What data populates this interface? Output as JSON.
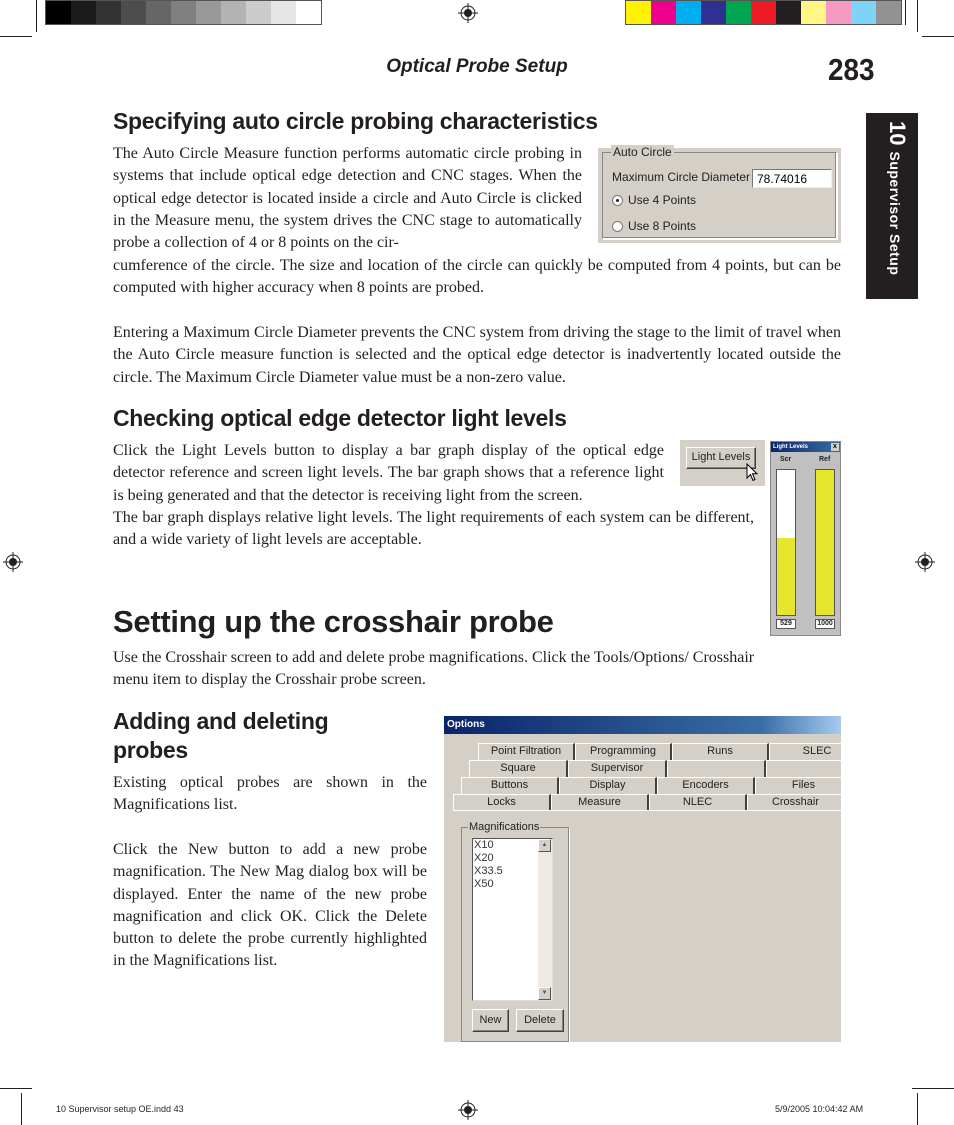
{
  "print_marks": {
    "grayscale_swatches": [
      "#000000",
      "#1a1a1a",
      "#333333",
      "#4d4d4d",
      "#666666",
      "#808080",
      "#999999",
      "#b3b3b3",
      "#cccccc",
      "#e6e6e6",
      "#ffffff"
    ],
    "color_swatches": [
      "#fff200",
      "#ec008c",
      "#00aeef",
      "#2e3192",
      "#00a651",
      "#ed1c24",
      "#231f20",
      "#fff685",
      "#f69ac4",
      "#7dd4f6",
      "#929292"
    ]
  },
  "header": {
    "running_head": "Optical Probe Setup",
    "page_number": "283"
  },
  "chapter_tab": {
    "number": "10",
    "name": "Supervisor Setup"
  },
  "sections": {
    "auto_circle": {
      "heading": "Specifying auto circle probing characteristics",
      "para1_wrapped": "The Auto Circle Measure function performs automatic circle probing in systems that include optical edge detection and CNC stages. When the optical edge detector is located inside a circle and Auto Circle is clicked in the Measure menu, the system drives the CNC stage to automatically probe a collection of 4 or 8 points on the cir-",
      "para1_cont": "cumference of the circle.  The size and location of the circle can quickly be computed from 4 points, but can be computed with higher accuracy when 8 points are probed.",
      "para2": "Entering a Maximum Circle Diameter prevents the CNC system from driving the stage to the limit of travel when the Auto Circle measure function is selected and the optical edge detector is inadvertently located outside the circle.  The Maximum Circle Diameter value must be a non-zero value."
    },
    "light_levels": {
      "heading": "Checking optical edge detector light levels",
      "para1": "Click the Light Levels button to display a bar graph display of the optical edge detector reference and screen light levels.  The bar graph shows that a reference light is being generated and that the detector is receiving light from the screen.",
      "para2": "The bar graph displays relative light levels. The light requirements of each system can be different, and a wide variety of light levels are acceptable."
    },
    "crosshair": {
      "heading": "Setting up the crosshair probe",
      "para": "Use the Crosshair screen to add and delete probe magnifications.   Click the Tools/Options/ Crosshair menu item to display the Crosshair probe screen."
    },
    "add_delete": {
      "heading_line1": "Adding and deleting",
      "heading_line2": "probes",
      "para1": "Existing optical probes are shown in the Magnifications list.",
      "para2": "Click the New button to add a new probe magnification.  The New Mag dialog box will be displayed. Enter the name of the new probe magnification and click OK.  Click the Delete button to delete the probe currently highlighted in the Magnifications list."
    }
  },
  "auto_circle_panel": {
    "group_label": "Auto Circle",
    "diameter_label": "Maximum Circle Diameter",
    "diameter_value": "78.74016",
    "options": [
      {
        "label": "Use 4 Points",
        "checked": true
      },
      {
        "label": "Use 8 Points",
        "checked": false
      }
    ]
  },
  "light_levels_button": {
    "label": "Light Levels"
  },
  "light_levels_window": {
    "title": "Light Levels",
    "close_glyph": "x",
    "scale_max": 1000,
    "bars": [
      {
        "label": "Scr",
        "value": 529
      },
      {
        "label": "Ref",
        "value": 1000
      }
    ],
    "bar_color": "#e6e62e"
  },
  "options_dialog": {
    "title": "Options",
    "tab_rows": [
      [
        "Point Filtration",
        "Programming",
        "Runs",
        "SLEC"
      ],
      [
        "Square",
        "Supervisor",
        "",
        ""
      ],
      [
        "Buttons",
        "Display",
        "Encoders",
        "Files"
      ],
      [
        "Locks",
        "Measure",
        "NLEC",
        "Crosshair"
      ]
    ],
    "active_tab": "Crosshair",
    "magnifications_label": "Magnifications",
    "magnifications": [
      "X10",
      "X20",
      "X33.5",
      "X50"
    ],
    "scroll_up": "▲",
    "scroll_down": "▼",
    "new_button": "New",
    "delete_button": "Delete"
  },
  "footer": {
    "file": "10 Supervisor setup OE.indd   43",
    "timestamp": "5/9/2005   10:04:42 AM"
  }
}
